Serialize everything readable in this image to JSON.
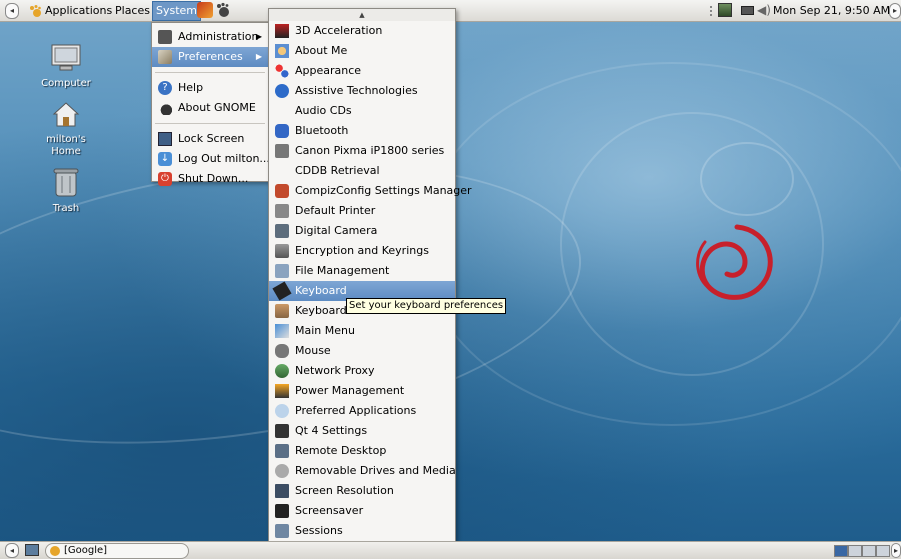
{
  "top_panel": {
    "applications_label": "Applications",
    "places_label": "Places",
    "system_label": "System",
    "clock": "Mon Sep 21,  9:50 AM"
  },
  "desktop": {
    "icons": [
      {
        "label": "Computer"
      },
      {
        "label": "milton's Home"
      },
      {
        "label": "Trash"
      }
    ]
  },
  "system_menu": {
    "items": [
      {
        "label": "Administration"
      },
      {
        "label": "Preferences"
      },
      {
        "label": "Help"
      },
      {
        "label": "About GNOME"
      },
      {
        "label": "Lock Screen"
      },
      {
        "label": "Log Out milton..."
      },
      {
        "label": "Shut Down..."
      }
    ]
  },
  "preferences_menu": {
    "items": [
      {
        "label": "3D Acceleration"
      },
      {
        "label": "About Me"
      },
      {
        "label": "Appearance"
      },
      {
        "label": "Assistive Technologies"
      },
      {
        "label": "Audio CDs"
      },
      {
        "label": "Bluetooth"
      },
      {
        "label": "Canon Pixma iP1800 series"
      },
      {
        "label": "CDDB Retrieval"
      },
      {
        "label": "CompizConfig Settings Manager"
      },
      {
        "label": "Default Printer"
      },
      {
        "label": "Digital Camera"
      },
      {
        "label": "Encryption and Keyrings"
      },
      {
        "label": "File Management"
      },
      {
        "label": "Keyboard"
      },
      {
        "label": "Keyboard Shortcuts"
      },
      {
        "label": "Main Menu"
      },
      {
        "label": "Mouse"
      },
      {
        "label": "Network Proxy"
      },
      {
        "label": "Power Management"
      },
      {
        "label": "Preferred Applications"
      },
      {
        "label": "Qt 4 Settings"
      },
      {
        "label": "Remote Desktop"
      },
      {
        "label": "Removable Drives and Media"
      },
      {
        "label": "Screen Resolution"
      },
      {
        "label": "Screensaver"
      },
      {
        "label": "Sessions"
      }
    ]
  },
  "tooltip": "Set your keyboard preferences",
  "bottom_panel": {
    "window_label": "[Google]"
  },
  "colors": {
    "highlight": "#6a95c8",
    "debian_swirl": "#c7202b"
  }
}
